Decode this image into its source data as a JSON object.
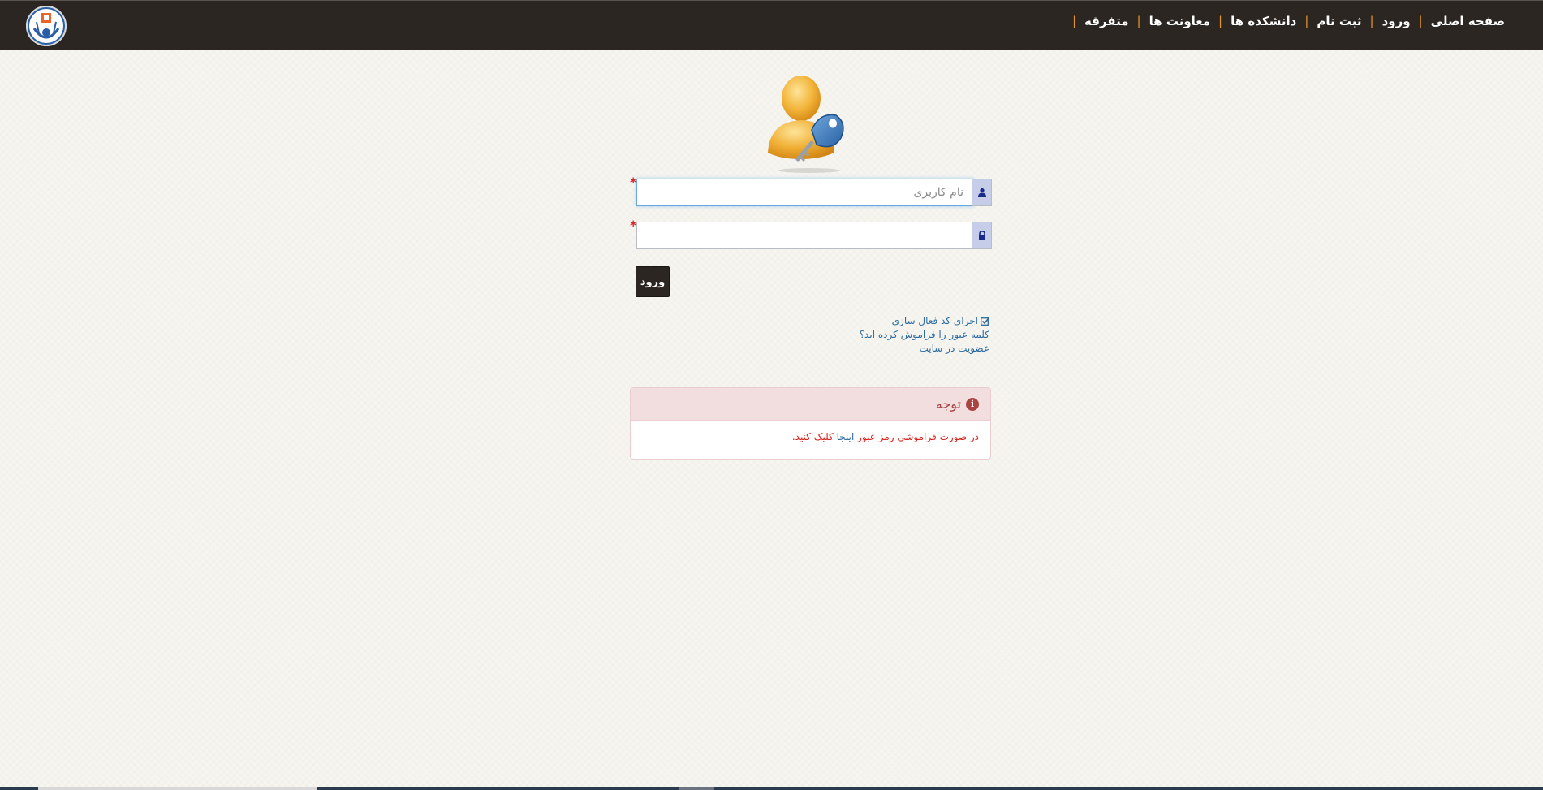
{
  "nav": {
    "items": [
      {
        "label": "صفحه اصلی"
      },
      {
        "label": "ورود"
      },
      {
        "label": "ثبت نام"
      },
      {
        "label": "دانشکده ها"
      },
      {
        "label": "معاونت ها"
      },
      {
        "label": "متفرقه"
      }
    ],
    "separator": "|"
  },
  "login": {
    "required_mark": "*",
    "username_placeholder": "نام کاربری",
    "username_value": "",
    "password_value": "",
    "submit_label": "ورود"
  },
  "links": {
    "activation": "اجرای کد فعال سازی",
    "forgot_password": "کلمه عبور را فراموش کرده اید؟",
    "register": "عضویت در سایت"
  },
  "alert": {
    "title": "توجه",
    "text_before": "در صورت فراموشی رمز عبور",
    "link": "اینجا",
    "text_after": "کلیک کنید."
  },
  "colors": {
    "topbar": "#2b2622",
    "nav_separator": "#e2942e",
    "link": "#2e6b9e",
    "alert_text": "#d9231d",
    "alert_title": "#a94442"
  }
}
